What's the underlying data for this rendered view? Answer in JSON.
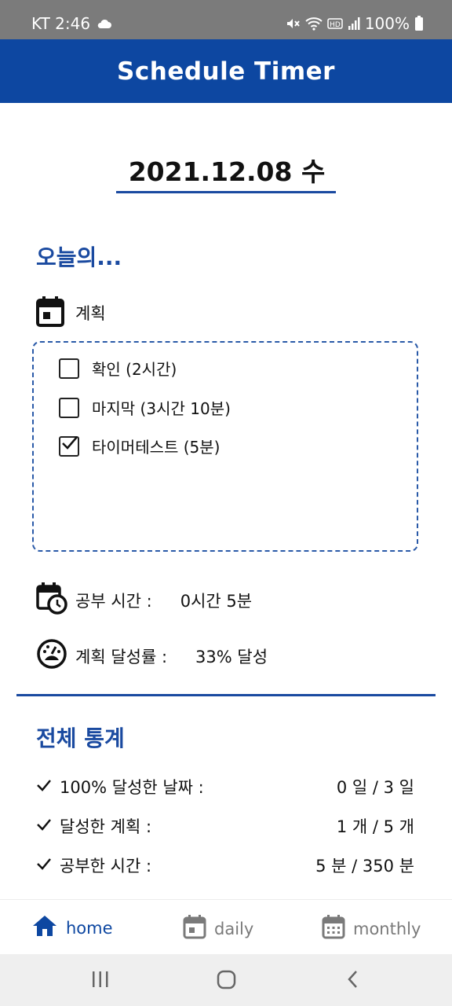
{
  "status_bar": {
    "carrier_time": "KT 2:46",
    "battery": "100%",
    "icons": [
      "cloud-icon",
      "mute-icon",
      "wifi-icon",
      "hd-icon",
      "signal-icon",
      "battery-icon"
    ]
  },
  "app": {
    "title": "Schedule Timer",
    "accent_color": "#0d47a1"
  },
  "date": "2021.12.08 수",
  "today": {
    "heading": "오늘의...",
    "plan_label": "계획",
    "tasks": [
      {
        "label": "확인 (2시간)",
        "checked": false
      },
      {
        "label": "마지막 (3시간 10분)",
        "checked": false
      },
      {
        "label": "타이머테스트 (5분)",
        "checked": true
      }
    ],
    "study_time_label": "공부 시간 :",
    "study_time_value": "0시간 5분",
    "achievement_label": "계획 달성률 :",
    "achievement_value": "33% 달성"
  },
  "stats": {
    "heading": "전체 통계",
    "rows": [
      {
        "label": "100% 달성한 날짜 :",
        "value": "0 일 / 3 일"
      },
      {
        "label": "달성한 계획 :",
        "value": "1 개 / 5 개"
      },
      {
        "label": "공부한 시간 :",
        "value": "5 분 / 350 분"
      }
    ]
  },
  "bottom_nav": {
    "items": [
      {
        "label": "home",
        "icon": "home-icon",
        "active": true
      },
      {
        "label": "daily",
        "icon": "calendar-day-icon",
        "active": false
      },
      {
        "label": "monthly",
        "icon": "calendar-month-icon",
        "active": false
      }
    ]
  },
  "system_nav": [
    "recents-icon",
    "home-circle-icon",
    "back-icon"
  ]
}
